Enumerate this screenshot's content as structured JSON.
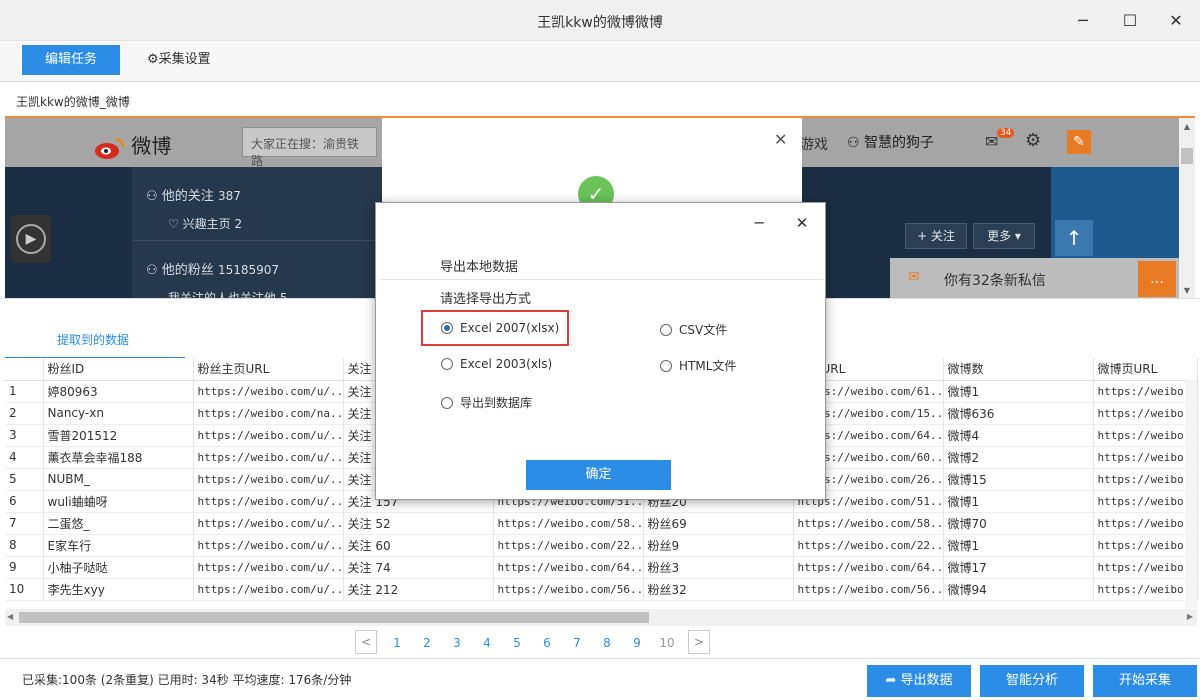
{
  "window": {
    "title": "王凯kkw的微博微博"
  },
  "toolbar": {
    "edit_task": "编辑任务",
    "settings": "采集设置"
  },
  "page_tab": "王凯kkw的微博_微博",
  "weibo": {
    "logo": "微博",
    "search_placeholder": "大家正在搜：渝贵铁路",
    "nav_game": "游戏",
    "user_name": "智慧的狗子",
    "mail_badge": "34",
    "follow_label": "他的关注",
    "follow_count": "387",
    "interest_label": "兴趣主页",
    "interest_count": "2",
    "fans_label": "他的粉丝",
    "fans_count": "15185907",
    "fans_sub": "我关注的人也关注他 5",
    "follow_btn": "+ 关注",
    "more_btn": "更多 ▾",
    "msg": "你有32条新私信"
  },
  "data_tab": "提取到的数据",
  "table": {
    "headers": [
      "",
      "粉丝ID",
      "粉丝主页URL",
      "关注",
      "",
      "",
      "微博URL",
      "微博数",
      "微博页URL"
    ],
    "rows": [
      [
        "1",
        "婷80963",
        "https://weibo.com/u/...",
        "关注",
        "",
        "",
        "https://weibo.com/61...",
        "微博1",
        "https://weibo.com"
      ],
      [
        "2",
        "Nancy-xn",
        "https://weibo.com/na...",
        "关注",
        "",
        "",
        "https://weibo.com/15...",
        "微博636",
        "https://weibo.com"
      ],
      [
        "3",
        "雪普201512",
        "https://weibo.com/u/...",
        "关注",
        "",
        "",
        "https://weibo.com/64...",
        "微博4",
        "https://weibo.com"
      ],
      [
        "4",
        "薰衣草会幸福188",
        "https://weibo.com/u/...",
        "关注",
        "",
        "",
        "https://weibo.com/60...",
        "微博2",
        "https://weibo.com"
      ],
      [
        "5",
        "NUBM_",
        "https://weibo.com/u/...",
        "关注",
        "",
        "",
        "https://weibo.com/26...",
        "微博15",
        "https://weibo.com"
      ],
      [
        "6",
        "wuli蛐蛐呀",
        "https://weibo.com/u/...",
        "关注 157",
        "https://weibo.com/51...",
        "粉丝20",
        "https://weibo.com/51...",
        "微博1",
        "https://weibo.com"
      ],
      [
        "7",
        "二蛋悠_",
        "https://weibo.com/u/...",
        "关注 52",
        "https://weibo.com/58...",
        "粉丝69",
        "https://weibo.com/58...",
        "微博70",
        "https://weibo.com"
      ],
      [
        "8",
        "E家车行",
        "https://weibo.com/u/...",
        "关注 60",
        "https://weibo.com/22...",
        "粉丝9",
        "https://weibo.com/22...",
        "微博1",
        "https://weibo.com"
      ],
      [
        "9",
        "小柚子哒哒",
        "https://weibo.com/u/...",
        "关注 74",
        "https://weibo.com/64...",
        "粉丝3",
        "https://weibo.com/64...",
        "微博17",
        "https://weibo.com"
      ],
      [
        "10",
        "李先生xyy",
        "https://weibo.com/u/...",
        "关注 212",
        "https://weibo.com/56...",
        "粉丝32",
        "https://weibo.com/56...",
        "微博94",
        "https://weibo.com"
      ]
    ]
  },
  "pager": {
    "pages": [
      "1",
      "2",
      "3",
      "4",
      "5",
      "6",
      "7",
      "8",
      "9",
      "10"
    ],
    "prev": "<",
    "next": ">"
  },
  "status": {
    "text": "已采集:100条 (2条重复)   已用时: 34秒  平均速度: 176条/分钟"
  },
  "actions": {
    "export": "导出数据",
    "analyze": "智能分析",
    "start": "开始采集"
  },
  "dialog": {
    "heading": "导出本地数据",
    "prompt": "请选择导出方式",
    "options": [
      "Excel 2007(xlsx)",
      "CSV文件",
      "Excel 2003(xls)",
      "HTML文件",
      "导出到数据库"
    ],
    "selected": "Excel 2007(xlsx)",
    "ok": "确定"
  },
  "colors": {
    "accent": "#2b8de5",
    "highlight": "#e03a3a",
    "orange": "#f18b3a"
  }
}
